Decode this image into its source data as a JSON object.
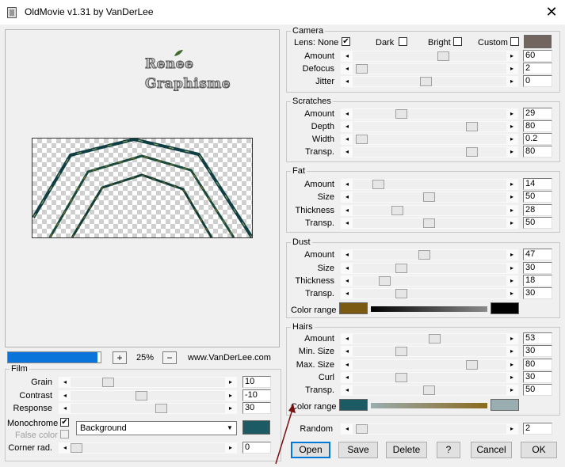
{
  "window": {
    "title": "OldMovie v1.31 by VanDerLee",
    "close_glyph": "✕"
  },
  "logo": {
    "line1": "Renee",
    "line2": "Graphisme"
  },
  "toolbar": {
    "progress_fraction": 0.97,
    "zoom_in": "+",
    "zoom_level": "25%",
    "zoom_out": "−",
    "website": "www.VanDerLee.com"
  },
  "film": {
    "legend": "Film",
    "grain": {
      "label": "Grain",
      "value": "10"
    },
    "contrast": {
      "label": "Contrast",
      "value": "-10"
    },
    "response": {
      "label": "Response",
      "value": "30"
    },
    "monochrome": {
      "label": "Monochrome",
      "checked": "✔"
    },
    "false_color": {
      "label": "False color"
    },
    "background_select": "Background",
    "mono_color": "#1c5b63",
    "corner": {
      "label": "Corner rad.",
      "value": "0"
    }
  },
  "camera": {
    "legend": "Camera",
    "lens_none": {
      "label": "Lens: None",
      "checked": "✔"
    },
    "dark": {
      "label": "Dark"
    },
    "bright": {
      "label": "Bright"
    },
    "custom": {
      "label": "Custom"
    },
    "custom_color": "#726560",
    "amount": {
      "label": "Amount",
      "value": "60"
    },
    "defocus": {
      "label": "Defocus",
      "value": "2"
    },
    "jitter": {
      "label": "Jitter",
      "value": "0"
    }
  },
  "scratches": {
    "legend": "Scratches",
    "amount": {
      "label": "Amount",
      "value": "29"
    },
    "depth": {
      "label": "Depth",
      "value": "80"
    },
    "width": {
      "label": "Width",
      "value": "0.2"
    },
    "transp": {
      "label": "Transp.",
      "value": "80"
    }
  },
  "fat": {
    "legend": "Fat",
    "amount": {
      "label": "Amount",
      "value": "14"
    },
    "size": {
      "label": "Size",
      "value": "50"
    },
    "thickness": {
      "label": "Thickness",
      "value": "28"
    },
    "transp": {
      "label": "Transp.",
      "value": "50"
    }
  },
  "dust": {
    "legend": "Dust",
    "amount": {
      "label": "Amount",
      "value": "47"
    },
    "size": {
      "label": "Size",
      "value": "30"
    },
    "thickness": {
      "label": "Thickness",
      "value": "18"
    },
    "transp": {
      "label": "Transp.",
      "value": "30"
    },
    "color_range": {
      "label": "Color range",
      "from": "#7a5a12",
      "to": "#000000"
    }
  },
  "hairs": {
    "legend": "Hairs",
    "amount": {
      "label": "Amount",
      "value": "53"
    },
    "min_size": {
      "label": "Min. Size",
      "value": "30"
    },
    "max_size": {
      "label": "Max. Size",
      "value": "80"
    },
    "curl": {
      "label": "Curl",
      "value": "30"
    },
    "transp": {
      "label": "Transp.",
      "value": "50"
    },
    "color_range": {
      "label": "Color range",
      "from": "#1c5b63",
      "to": "#9aadb0",
      "mid": "#8a6a1e"
    }
  },
  "random": {
    "label": "Random",
    "value": "2"
  },
  "buttons": {
    "open": "Open",
    "save": "Save",
    "delete": "Delete",
    "help": "?",
    "cancel": "Cancel",
    "ok": "OK"
  },
  "annotation_color": "#7a1010"
}
